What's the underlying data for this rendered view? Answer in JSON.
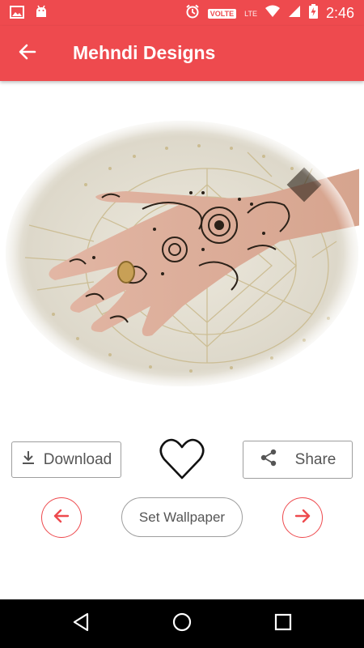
{
  "status_bar": {
    "time": "2:46",
    "volte": "VOLTE",
    "lte": "LTE",
    "icons": [
      "image-icon",
      "android-icon",
      "alarm-icon",
      "wifi-icon",
      "signal-icon",
      "battery-charging-icon"
    ]
  },
  "app_bar": {
    "title": "Mehndi Designs",
    "back_icon": "arrow-left-icon"
  },
  "content": {
    "image_subject": "henna-hand-photo"
  },
  "actions": {
    "download_label": "Download",
    "share_label": "Share",
    "set_wallpaper_label": "Set Wallpaper"
  },
  "colors": {
    "primary": "#ee4a4e",
    "border_gray": "#9e9e9e",
    "text_gray": "#555555"
  }
}
